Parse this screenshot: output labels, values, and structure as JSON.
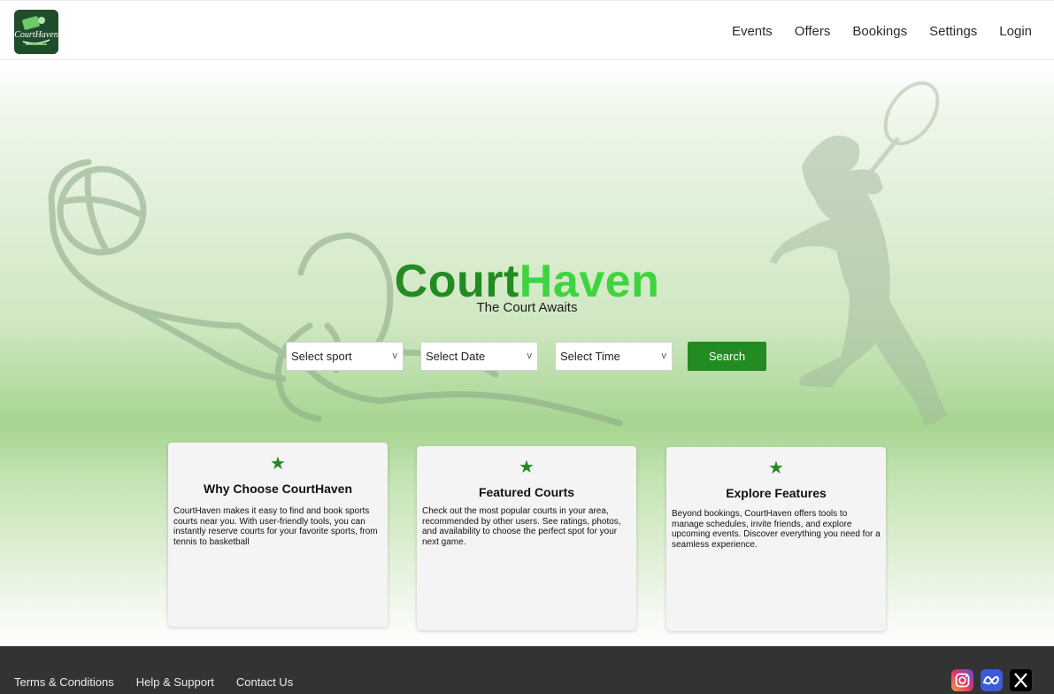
{
  "header": {
    "logo_text": "CourtHaven",
    "nav": [
      "Events",
      "Offers",
      "Bookings",
      "Settings",
      "Login"
    ]
  },
  "hero": {
    "brand_part1": "Court",
    "brand_part2": "Haven",
    "tagline": "The Court Awaits",
    "selects": [
      {
        "label": "Select sport",
        "chevron": "v"
      },
      {
        "label": "Select Date",
        "chevron": "v"
      },
      {
        "label": "Select Time",
        "chevron": "v"
      }
    ],
    "search_label": "Search"
  },
  "cards": [
    {
      "icon": "★",
      "title": "Why Choose CourtHaven",
      "body": "CourtHaven makes it easy to find and book sports courts near you. With user-friendly tools, you can instantly reserve courts for your favorite sports, from tennis to basketball"
    },
    {
      "icon": "★",
      "title": "Featured Courts",
      "body": "Check out the most popular courts in your area, recommended by other users. See ratings, photos, and availability to choose the perfect spot for your next game."
    },
    {
      "icon": "★",
      "title": "Explore Features",
      "body": "Beyond bookings, CourtHaven offers tools to manage schedules, invite friends, and explore upcoming events. Discover everything you need for a seamless experience."
    }
  ],
  "footer": {
    "links": [
      "Terms & Conditions",
      "Help & Support",
      "Contact Us"
    ],
    "social": [
      "instagram-icon",
      "meta-icon",
      "x-icon"
    ]
  },
  "colors": {
    "accent": "#228b22",
    "accent_light": "#3fd43f",
    "footer_bg": "#333333",
    "logo_bg": "#1f4d2c"
  }
}
